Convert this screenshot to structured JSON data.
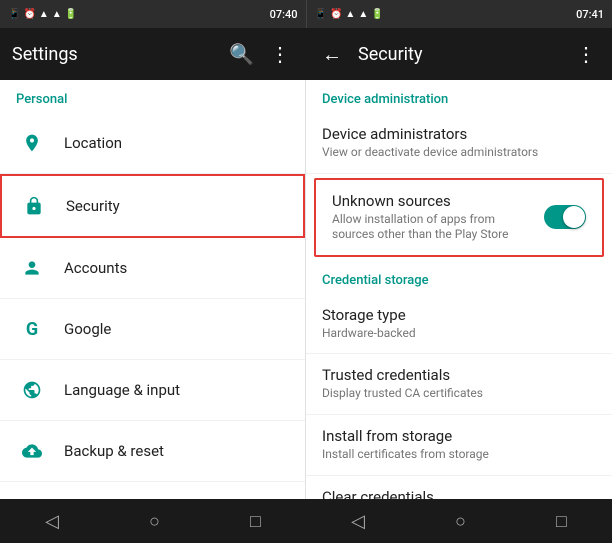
{
  "app": {
    "title": "Settings & Security"
  },
  "left_status_bar": {
    "time": "07:40",
    "icons": "☎ ⏰ ▲ WiFi Batt"
  },
  "right_status_bar": {
    "time": "07:41",
    "icons": "☎ ⏰ ▲ WiFi Batt"
  },
  "left_toolbar": {
    "title": "Settings",
    "search_label": "🔍",
    "more_label": "⋮"
  },
  "right_toolbar": {
    "back_label": "←",
    "title": "Security",
    "more_label": "⋮"
  },
  "settings_section": {
    "label": "Personal"
  },
  "settings_items": [
    {
      "icon": "📍",
      "label": "Location"
    },
    {
      "icon": "🔒",
      "label": "Security",
      "selected": true
    },
    {
      "icon": "👤",
      "label": "Accounts"
    },
    {
      "icon": "G",
      "label": "Google"
    },
    {
      "icon": "🌐",
      "label": "Language & input"
    },
    {
      "icon": "☁",
      "label": "Backup & reset"
    }
  ],
  "security_sections": [
    {
      "label": "Device administration",
      "items": [
        {
          "title": "Device administrators",
          "subtitle": "View or deactivate device administrators",
          "highlighted": false,
          "has_toggle": false
        },
        {
          "title": "Unknown sources",
          "subtitle": "Allow installation of apps from sources other than the Play Store",
          "highlighted": true,
          "has_toggle": true,
          "toggle_on": true
        }
      ]
    },
    {
      "label": "Credential storage",
      "items": [
        {
          "title": "Storage type",
          "subtitle": "Hardware-backed",
          "highlighted": false,
          "has_toggle": false
        },
        {
          "title": "Trusted credentials",
          "subtitle": "Display trusted CA certificates",
          "highlighted": false,
          "has_toggle": false
        },
        {
          "title": "Install from storage",
          "subtitle": "Install certificates from storage",
          "highlighted": false,
          "has_toggle": false
        },
        {
          "title": "Clear credentials",
          "subtitle": "",
          "highlighted": false,
          "has_toggle": false
        }
      ]
    }
  ],
  "left_nav": {
    "back": "◁",
    "home": "○",
    "recent": "□"
  },
  "right_nav": {
    "back": "◁",
    "home": "○",
    "recent": "□"
  }
}
